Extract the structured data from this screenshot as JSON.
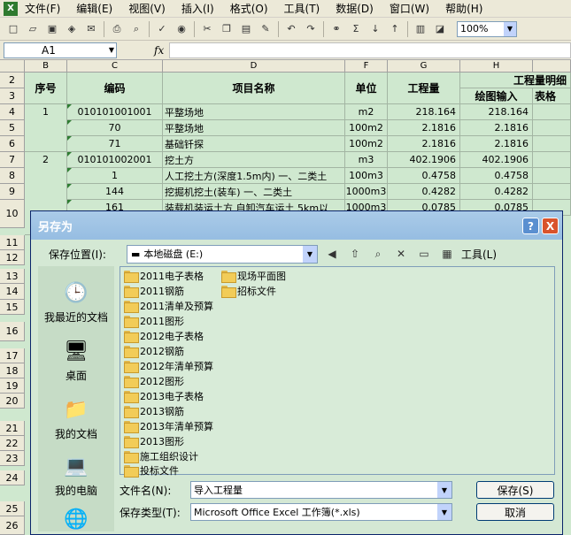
{
  "menu": {
    "items": [
      "文件(F)",
      "编辑(E)",
      "视图(V)",
      "插入(I)",
      "格式(O)",
      "工具(T)",
      "数据(D)",
      "窗口(W)",
      "帮助(H)"
    ]
  },
  "toolbar": {
    "zoom": "100%"
  },
  "formula_bar": {
    "name_box": "A1",
    "fx": "fx"
  },
  "sheet": {
    "columns": [
      "B",
      "C",
      "D",
      "F",
      "G",
      "H"
    ],
    "rows": [
      "2",
      "3",
      "4",
      "5",
      "6",
      "7",
      "8",
      "9",
      "10",
      "11",
      "12",
      "13",
      "14",
      "15",
      "16",
      "17",
      "18",
      "19",
      "20",
      "21",
      "22",
      "23",
      "24",
      "25",
      "26"
    ],
    "header": {
      "seq": "序号",
      "code": "编码",
      "name": "项目名称",
      "unit": "单位",
      "qty": "工程量",
      "detail": "工程量明细",
      "drawing_input": "绘图输入",
      "table_input": "表格"
    },
    "data_rows": [
      {
        "seq": "1",
        "code": "010101001001",
        "name": "平整场地",
        "unit": "m2",
        "qty": "218.164",
        "drawing": "218.164"
      },
      {
        "seq": "",
        "code": "70",
        "name": "平整场地",
        "unit": "100m2",
        "qty": "2.1816",
        "drawing": "2.1816"
      },
      {
        "seq": "",
        "code": "71",
        "name": "基础钎探",
        "unit": "100m2",
        "qty": "2.1816",
        "drawing": "2.1816"
      },
      {
        "seq": "2",
        "code": "010101002001",
        "name": "挖土方",
        "unit": "m3",
        "qty": "402.1906",
        "drawing": "402.1906"
      },
      {
        "seq": "",
        "code": "1",
        "name": "人工挖土方(深度1.5m内) 一、二类土",
        "unit": "100m3",
        "qty": "0.4758",
        "drawing": "0.4758"
      },
      {
        "seq": "",
        "code": "144",
        "name": "挖掘机挖土(装车) 一、二类土",
        "unit": "1000m3",
        "qty": "0.4282",
        "drawing": "0.4282"
      },
      {
        "seq": "",
        "code": "161",
        "name": "装载机装运土方 自卸汽车运土 5km以",
        "unit": "1000m3",
        "qty": "0.0785",
        "drawing": "0.0785"
      }
    ]
  },
  "dialog": {
    "title": "另存为",
    "help_btn": "?",
    "close_btn": "X",
    "save_in_label": "保存位置(I):",
    "save_in_value": "本地磁盘 (E:)",
    "tools_label": "工具(L)",
    "places": [
      "我最近的文档",
      "桌面",
      "我的文档",
      "我的电脑"
    ],
    "folders_col1": [
      "2011电子表格",
      "2011钢筋",
      "2011清单及预算",
      "2011图形",
      "2012电子表格",
      "2012钢筋",
      "2012年清单预算",
      "2012图形",
      "2013电子表格",
      "2013钢筋",
      "2013年清单预算",
      "2013图形",
      "施工组织设计",
      "投标文件"
    ],
    "folders_col2": [
      "现场平面图",
      "招标文件"
    ],
    "filename_label": "文件名(N):",
    "filename_value": "导入工程量",
    "filetype_label": "保存类型(T):",
    "filetype_value": "Microsoft Office Excel 工作簿(*.xls)",
    "save_button": "保存(S)",
    "cancel_button": "取消"
  }
}
